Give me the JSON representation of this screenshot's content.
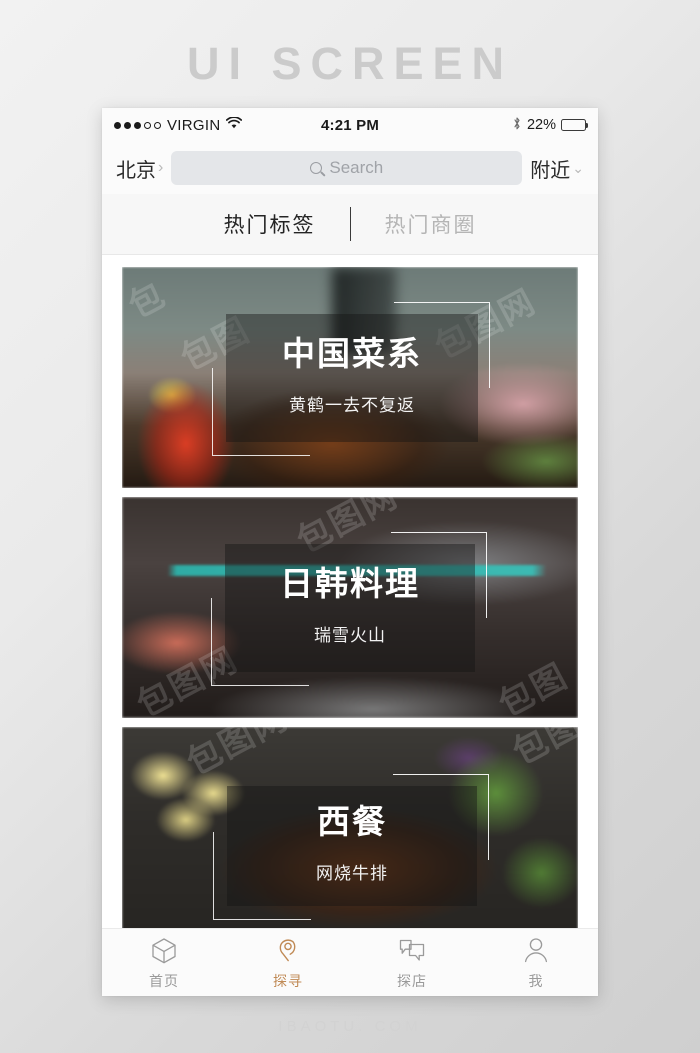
{
  "page": {
    "heading": "UI SCREEN",
    "footer": "IBAOTU. COM"
  },
  "colors": {
    "accent": "#c08a55",
    "tab_active": "#242424",
    "tab_inactive": "#b5b5b5",
    "nav_inactive": "#9a9a9a",
    "search_bg": "#e4e6e9",
    "page_bg": "#eaeaea"
  },
  "status_bar": {
    "signal_dots_filled": 3,
    "signal_dots_total": 5,
    "carrier": "VIRGIN",
    "wifi_icon": "wifi-icon",
    "time": "4:21 PM",
    "bluetooth_icon": "bluetooth-icon",
    "battery_percent": "22%",
    "battery_level": 22
  },
  "search_header": {
    "city": "北京",
    "city_chevron": "›",
    "search_placeholder": "Search",
    "search_value": "",
    "search_icon": "search-icon",
    "nearby": "附近",
    "nearby_chevron": "⌄"
  },
  "tabs": [
    {
      "label": "热门标签",
      "active": true
    },
    {
      "label": "热门商圈",
      "active": false
    }
  ],
  "cards": [
    {
      "title": "中国菜系",
      "subtitle": "黄鹤一去不复返",
      "image_desc": "blurred-chinese-food-kitchen"
    },
    {
      "title": "日韩料理",
      "subtitle": "瑞雪火山",
      "image_desc": "blurred-japanese-korean-sushi"
    },
    {
      "title": "西餐",
      "subtitle": "网烧牛排",
      "image_desc": "blurred-western-steak"
    }
  ],
  "bottom_nav": [
    {
      "label": "首页",
      "icon": "cube-icon",
      "active": false
    },
    {
      "label": "探寻",
      "icon": "location-pin-icon",
      "active": true
    },
    {
      "label": "探店",
      "icon": "chat-bubbles-icon",
      "active": false
    },
    {
      "label": "我",
      "icon": "person-icon",
      "active": false
    }
  ],
  "watermarks": [
    "包图网",
    "包图网",
    "包图网",
    "包图网",
    "包图网",
    "包图网"
  ]
}
